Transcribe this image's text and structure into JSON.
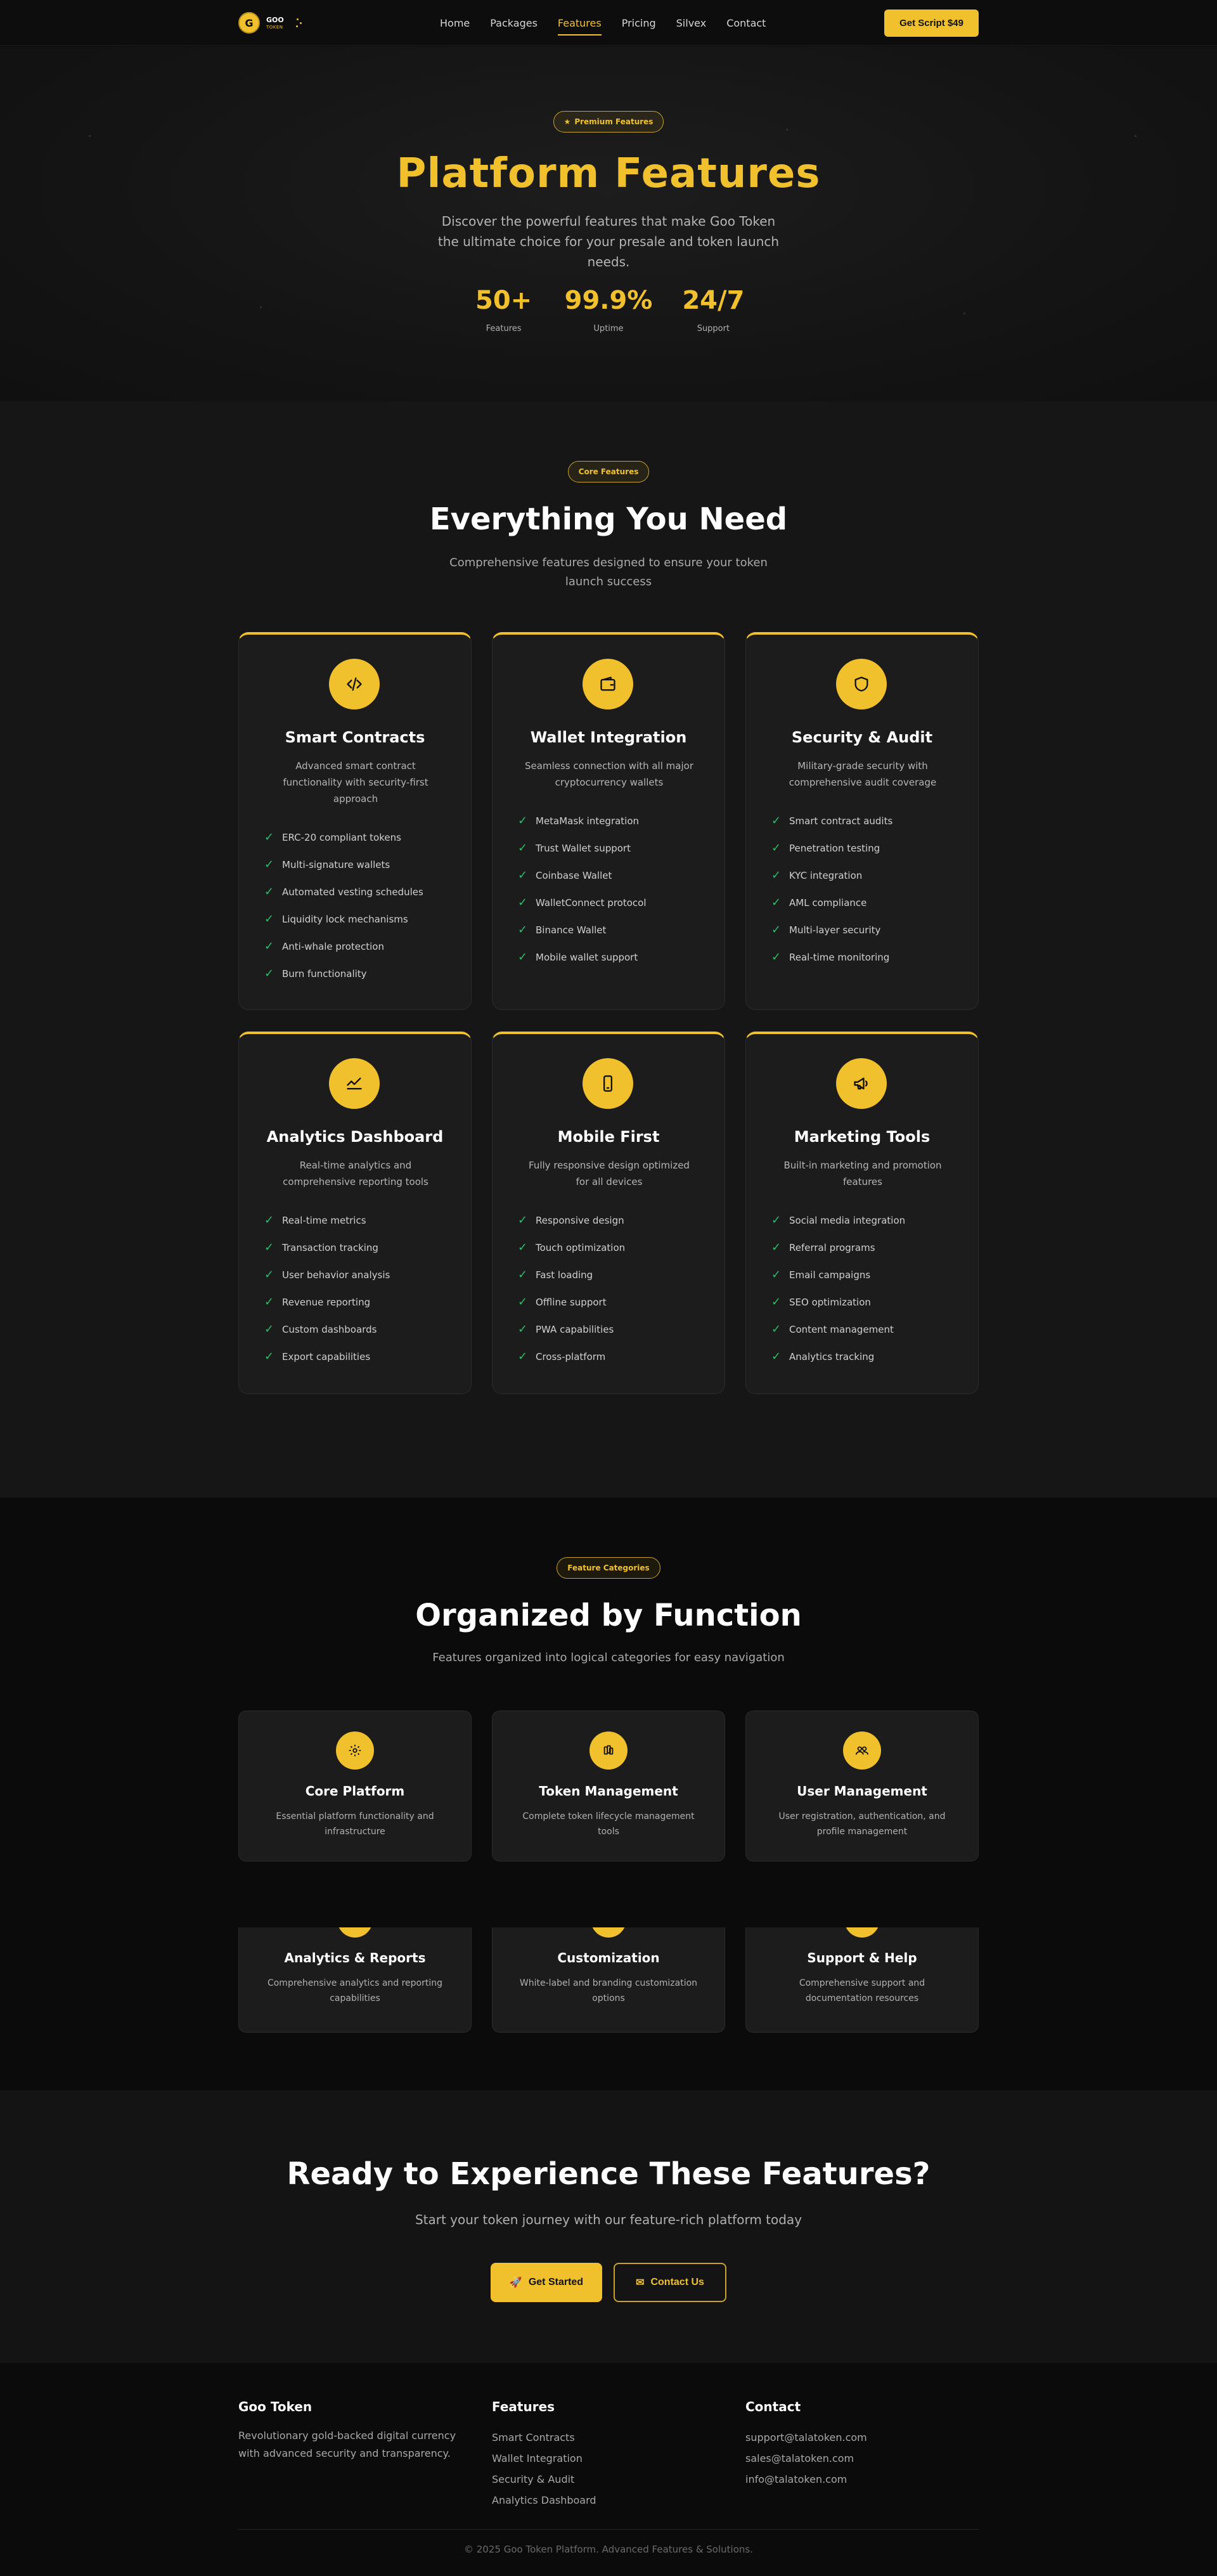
{
  "nav": {
    "brand_name": "GOO",
    "brand_sub": "TOKEN",
    "logo_letter": "G",
    "links": [
      "Home",
      "Packages",
      "Features",
      "Pricing",
      "Silvex",
      "Contact"
    ],
    "active": "Features",
    "cta": "Get Script $49"
  },
  "hero": {
    "badge": "Premium Features",
    "title": "Platform Features",
    "subtitle": "Discover the powerful features that make Goo Token the ultimate choice for your presale and token launch needs.",
    "stats": [
      {
        "value": "50+",
        "label": "Features"
      },
      {
        "value": "99.9%",
        "label": "Uptime"
      },
      {
        "value": "24/7",
        "label": "Support"
      }
    ]
  },
  "core": {
    "badge": "Core Features",
    "title": "Everything You Need",
    "subtitle": "Comprehensive features designed to ensure your token launch success",
    "cards": [
      {
        "icon": "code-icon",
        "title": "Smart Contracts",
        "desc": "Advanced smart contract functionality with security-first approach",
        "items": [
          "ERC-20 compliant tokens",
          "Multi-signature wallets",
          "Automated vesting schedules",
          "Liquidity lock mechanisms",
          "Anti-whale protection",
          "Burn functionality"
        ]
      },
      {
        "icon": "wallet-icon",
        "title": "Wallet Integration",
        "desc": "Seamless connection with all major cryptocurrency wallets",
        "items": [
          "MetaMask integration",
          "Trust Wallet support",
          "Coinbase Wallet",
          "WalletConnect protocol",
          "Binance Wallet",
          "Mobile wallet support"
        ]
      },
      {
        "icon": "shield-icon",
        "title": "Security & Audit",
        "desc": "Military-grade security with comprehensive audit coverage",
        "items": [
          "Smart contract audits",
          "Penetration testing",
          "KYC integration",
          "AML compliance",
          "Multi-layer security",
          "Real-time monitoring"
        ]
      },
      {
        "icon": "chart-line-icon",
        "title": "Analytics Dashboard",
        "desc": "Real-time analytics and comprehensive reporting tools",
        "items": [
          "Real-time metrics",
          "Transaction tracking",
          "User behavior analysis",
          "Revenue reporting",
          "Custom dashboards",
          "Export capabilities"
        ]
      },
      {
        "icon": "mobile-icon",
        "title": "Mobile First",
        "desc": "Fully responsive design optimized for all devices",
        "items": [
          "Responsive design",
          "Touch optimization",
          "Fast loading",
          "Offline support",
          "PWA capabilities",
          "Cross-platform"
        ]
      },
      {
        "icon": "megaphone-icon",
        "title": "Marketing Tools",
        "desc": "Built-in marketing and promotion features",
        "items": [
          "Social media integration",
          "Referral programs",
          "Email campaigns",
          "SEO optimization",
          "Content management",
          "Analytics tracking"
        ]
      }
    ]
  },
  "categories": {
    "badge": "Feature Categories",
    "title": "Organized by Function",
    "subtitle": "Features organized into logical categories for easy navigation",
    "items": [
      {
        "icon": "gear-icon",
        "title": "Core Platform",
        "desc": "Essential platform functionality and infrastructure"
      },
      {
        "icon": "coins-icon",
        "title": "Token Management",
        "desc": "Complete token lifecycle management tools"
      },
      {
        "icon": "users-icon",
        "title": "User Management",
        "desc": "User registration, authentication, and profile management"
      },
      {
        "icon": "analytics-icon",
        "title": "Analytics & Reports",
        "desc": "Comprehensive analytics and reporting capabilities"
      },
      {
        "icon": "palette-icon",
        "title": "Customization",
        "desc": "White-label and branding customization options"
      },
      {
        "icon": "support-icon",
        "title": "Support & Help",
        "desc": "Comprehensive support and documentation resources"
      }
    ]
  },
  "cta": {
    "title": "Ready to Experience These Features?",
    "subtitle": "Start your token journey with our feature-rich platform today",
    "primary": "Get Started",
    "secondary": "Contact Us"
  },
  "footer": {
    "col1_title": "Goo Token",
    "col1_text": "Revolutionary gold-backed digital currency with advanced security and transparency.",
    "col2_title": "Features",
    "col2_links": [
      "Smart Contracts",
      "Wallet Integration",
      "Security & Audit",
      "Analytics Dashboard"
    ],
    "col3_title": "Contact",
    "col3_links": [
      "support@talatoken.com",
      "sales@talatoken.com",
      "info@talatoken.com"
    ],
    "copyright": "© 2025 Goo Token Platform. Advanced Features & Solutions."
  },
  "colors": {
    "accent": "#f0c12c",
    "check": "#2bbf6a",
    "bg": "#0b0b0b",
    "card": "#1c1c1c"
  }
}
